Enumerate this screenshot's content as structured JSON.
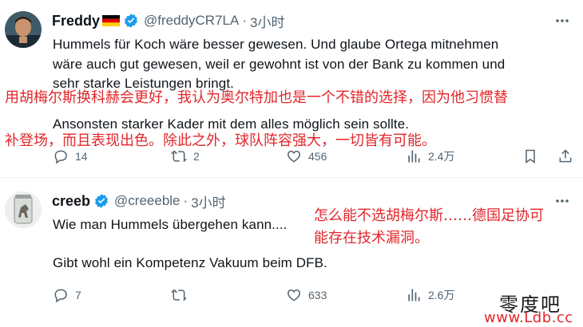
{
  "tweets": [
    {
      "author": {
        "name": "Freddy",
        "handle": "@freddyCR7LA",
        "verified": true,
        "flag": "de-flag"
      },
      "dot": "·",
      "time": "3小时",
      "lines": [
        "Hummels für Koch wäre besser gewesen. Und glaube Ortega mitnehmen",
        "wäre auch gut gewesen, weil er gewohnt ist von der Bank zu kommen und",
        "sehr starke Leistungen bringt.",
        "Ansonsten starker Kader mit dem alles möglich sein sollte."
      ],
      "translation": [
        "用胡梅尔斯换科赫会更好，我认为奥尔特加也是一个不错的选择，因为他习惯替",
        "补登场，而且表现出色。除此之外，球队阵容强大，一切皆有可能。"
      ],
      "stats": {
        "replies": "14",
        "reposts": "2",
        "likes": "456",
        "views": "2.4万"
      }
    },
    {
      "author": {
        "name": "creeb",
        "handle": "@creeeble",
        "verified": true
      },
      "dot": "·",
      "time": "3小时",
      "lines": [
        "Wie man Hummels übergehen kann....",
        "Gibt wohl ein Kompetenz Vakuum beim DFB."
      ],
      "translation": [
        "怎么能不选胡梅尔斯……德国足协可",
        "能存在技术漏洞。"
      ],
      "stats": {
        "replies": "7",
        "reposts": "",
        "likes": "633",
        "views": "2.6万"
      }
    }
  ],
  "watermark": {
    "line1": "零度吧",
    "line2": "www.Ldb.cc"
  },
  "colors": {
    "accent": "#1d9bf0",
    "muted": "#536471",
    "overlay": "#e3262b"
  },
  "icons": [
    "more-icon",
    "reply-icon",
    "repost-icon",
    "like-icon",
    "views-icon",
    "bookmark-icon",
    "share-icon",
    "verified-icon"
  ]
}
